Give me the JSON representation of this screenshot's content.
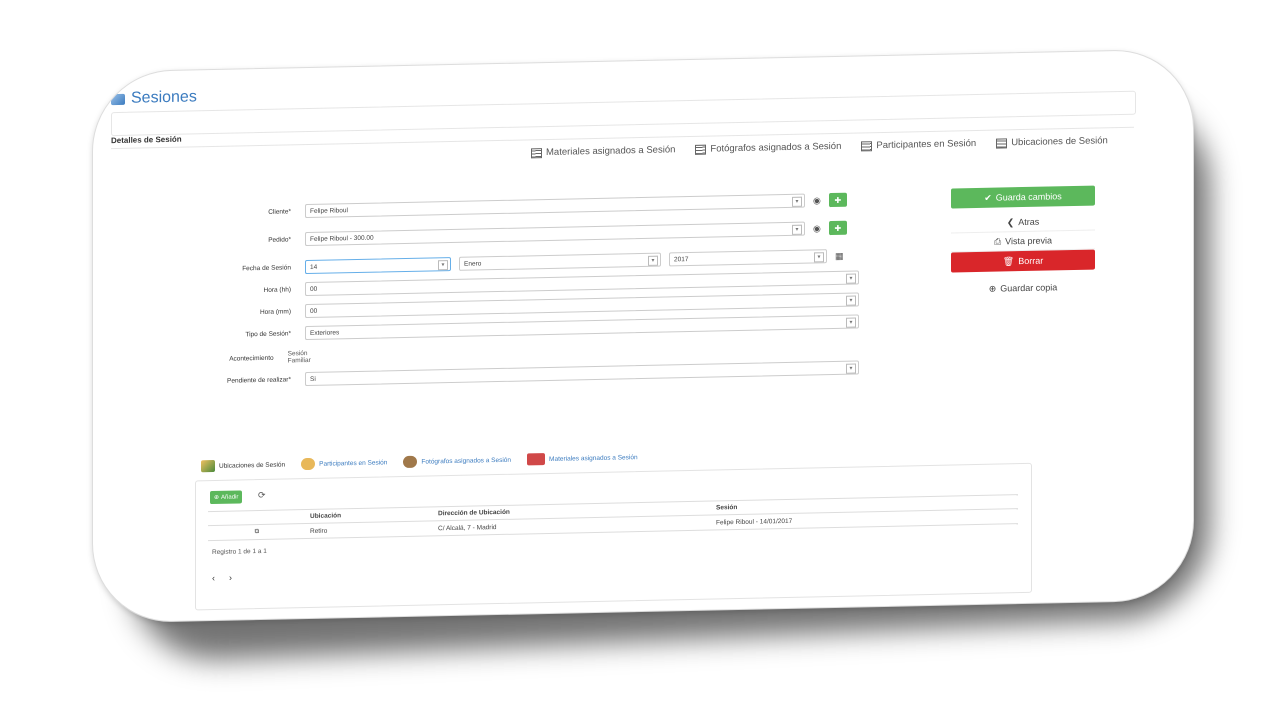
{
  "app": {
    "title": "Sesiones",
    "section_title": "Detalles de Sesión"
  },
  "top_tabs": [
    {
      "label": "Materiales asignados a Sesión"
    },
    {
      "label": "Fotógrafos asignados a Sesión"
    },
    {
      "label": "Participantes en Sesión"
    },
    {
      "label": "Ubicaciones de Sesión"
    }
  ],
  "form": {
    "cliente": {
      "label": "Cliente*",
      "value": "Felipe Riboul"
    },
    "pedido": {
      "label": "Pedido*",
      "value": "Felipe Riboul - 300.00"
    },
    "fecha": {
      "label": "Fecha de Sesión",
      "day": "14",
      "month": "Enero",
      "year": "2017"
    },
    "hora_hh": {
      "label": "Hora (hh)",
      "value": "00"
    },
    "hora_mm": {
      "label": "Hora (mm)",
      "value": "00"
    },
    "tipo": {
      "label": "Tipo de Sesión*",
      "value": "Exteriores"
    },
    "acontecimiento": {
      "label": "Acontecimiento",
      "value": "Sesión Familiar"
    },
    "pendiente": {
      "label": "Pendiente de realizar*",
      "value": "Si"
    }
  },
  "actions": {
    "save": "Guarda cambios",
    "back": "Atras",
    "preview": "Vista previa",
    "delete": "Borrar",
    "copy": "Guardar copia"
  },
  "bottom_tabs": [
    {
      "label": "Ubicaciones de Sesión"
    },
    {
      "label": "Participantes en Sesión"
    },
    {
      "label": "Fotógrafos asignados a Sesión"
    },
    {
      "label": "Materiales asignados a Sesión"
    }
  ],
  "grid": {
    "add_label": "Añadir",
    "columns": [
      "Ubicación",
      "Dirección de Ubicación",
      "Sesión"
    ],
    "rows": [
      {
        "ubicacion": "Retiro",
        "direccion": "C/ Alcalá, 7 - Madrid",
        "sesion": "Felipe Riboul - 14/01/2017"
      }
    ],
    "records": "Registro 1 de 1 a 1"
  },
  "colors": {
    "accent": "#3b7bbf",
    "green": "#5cb85c",
    "red": "#d9262a"
  }
}
